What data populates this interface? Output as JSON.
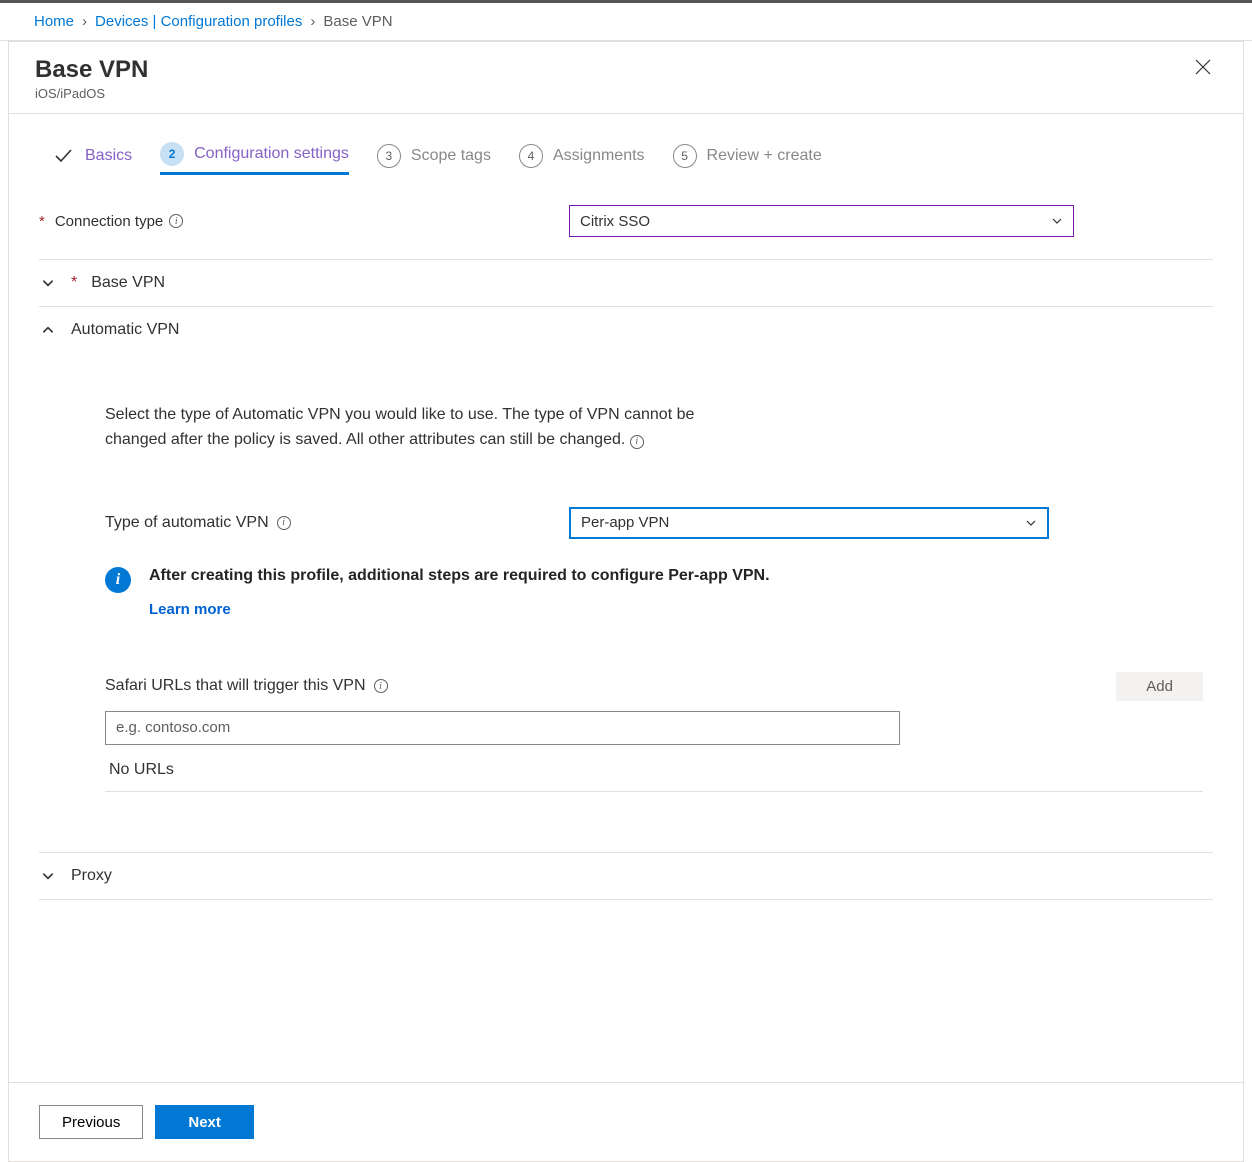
{
  "breadcrumb": {
    "items": [
      "Home",
      "Devices | Configuration profiles"
    ],
    "current": "Base VPN"
  },
  "header": {
    "title": "Base VPN",
    "subtitle": "iOS/iPadOS"
  },
  "wizard": {
    "steps": [
      {
        "num": "",
        "label": "Basics"
      },
      {
        "num": "2",
        "label": "Configuration settings"
      },
      {
        "num": "3",
        "label": "Scope tags"
      },
      {
        "num": "4",
        "label": "Assignments"
      },
      {
        "num": "5",
        "label": "Review + create"
      }
    ]
  },
  "form": {
    "connection_type_label": "Connection type",
    "connection_type_value": "Citrix SSO",
    "base_vpn_label": "Base VPN",
    "auto_vpn_label": "Automatic VPN",
    "auto_vpn_help": "Select the type of Automatic VPN you would like to use. The type of VPN cannot be changed after the policy is saved. All other attributes can still be changed.",
    "auto_vpn_type_label": "Type of automatic VPN",
    "auto_vpn_type_value": "Per-app VPN",
    "info_message": "After creating this profile, additional steps are required to configure Per-app VPN.",
    "learn_more": "Learn more",
    "safari_label": "Safari URLs that will trigger this VPN",
    "add_button": "Add",
    "safari_placeholder": "e.g. contoso.com",
    "no_urls": "No URLs",
    "proxy_label": "Proxy"
  },
  "footer": {
    "previous": "Previous",
    "next": "Next"
  }
}
